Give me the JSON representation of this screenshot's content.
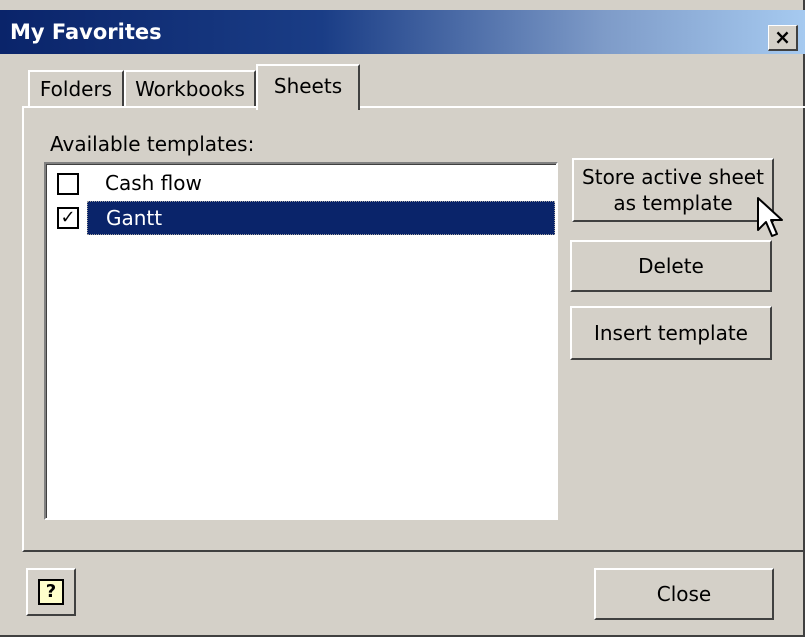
{
  "window": {
    "title": "My Favorites",
    "close_glyph": "×"
  },
  "tabs": [
    {
      "label": "Folders",
      "selected": false
    },
    {
      "label": "Workbooks",
      "selected": false
    },
    {
      "label": "Sheets",
      "selected": true
    }
  ],
  "templates": {
    "label": "Available templates:",
    "items": [
      {
        "label": "Cash flow",
        "checked": false,
        "selected": false,
        "check_glyph": ""
      },
      {
        "label": "Gantt",
        "checked": true,
        "selected": true,
        "check_glyph": "✓"
      }
    ]
  },
  "buttons": {
    "store_line1": "Store active sheet",
    "store_line2": "as template",
    "delete": "Delete",
    "insert": "Insert template",
    "close": "Close",
    "help_glyph": "?"
  },
  "icons": {
    "help": "help-icon",
    "cursor": "arrow-cursor-icon"
  },
  "colors": {
    "dialog_bg": "#d4d0c8",
    "title_start": "#0a246a",
    "title_end": "#a6caf0",
    "selection": "#0a246a"
  }
}
